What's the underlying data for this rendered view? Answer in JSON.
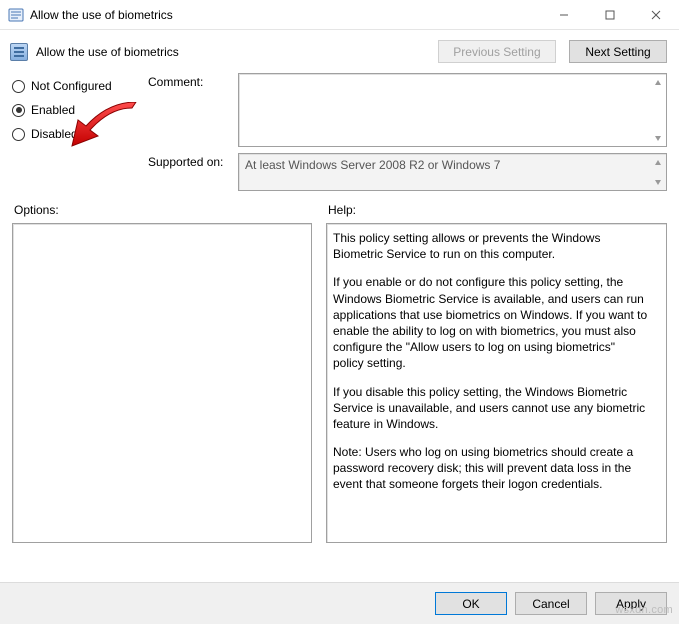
{
  "window": {
    "title": "Allow the use of biometrics"
  },
  "header": {
    "policy_title": "Allow the use of biometrics",
    "previous_setting": "Previous Setting",
    "next_setting": "Next Setting"
  },
  "radios": {
    "not_configured": "Not Configured",
    "enabled": "Enabled",
    "disabled": "Disabled",
    "selected": "enabled"
  },
  "labels": {
    "comment": "Comment:",
    "supported_on": "Supported on:",
    "options": "Options:",
    "help": "Help:"
  },
  "fields": {
    "comment_value": "",
    "supported_on_value": "At least Windows Server 2008 R2 or Windows 7"
  },
  "help": {
    "p1": "This policy setting allows or prevents the Windows Biometric Service to run on this computer.",
    "p2": "If you enable or do not configure this policy setting, the Windows Biometric Service is available, and users can run applications that use biometrics on Windows. If you want to enable the ability to log on with biometrics, you must also configure the \"Allow users to log on using biometrics\" policy setting.",
    "p3": "If you disable this policy setting, the Windows Biometric Service is unavailable, and users cannot use any biometric feature in Windows.",
    "p4": "Note: Users who log on using biometrics should create a password recovery disk; this will prevent data loss in the event that someone forgets their logon credentials."
  },
  "buttons": {
    "ok": "OK",
    "cancel": "Cancel",
    "apply": "Apply"
  },
  "watermark": "wsxdn.com"
}
